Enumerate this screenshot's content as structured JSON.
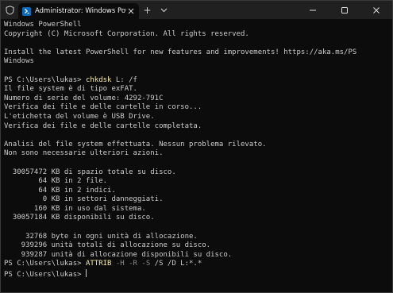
{
  "window": {
    "tab_title": "Administrator: Windows PowerShell",
    "new_tab_glyph": "+",
    "dropdown_glyph": "⌄"
  },
  "icons": [
    "shield-icon",
    "powershell-icon",
    "close-icon",
    "plus-icon",
    "chevron-down-icon",
    "minimize-icon",
    "maximize-icon",
    "window-close-icon"
  ],
  "colors": {
    "background": "#0c0c0c",
    "titlebar": "#202020",
    "text": "#cccccc",
    "command": "#f9f1a5",
    "parameter": "#8a8a8a",
    "powershell_icon": "#0b6ab8"
  },
  "console": {
    "lines": [
      {
        "segments": [
          {
            "text": "Windows PowerShell",
            "style": "plain"
          }
        ]
      },
      {
        "segments": [
          {
            "text": "Copyright (C) Microsoft Corporation. All rights reserved.",
            "style": "plain"
          }
        ]
      },
      {
        "segments": [
          {
            "text": "",
            "style": "plain"
          }
        ]
      },
      {
        "segments": [
          {
            "text": "Install the latest PowerShell for new features and improvements! https://aka.ms/PS",
            "style": "plain"
          }
        ]
      },
      {
        "segments": [
          {
            "text": "Windows",
            "style": "plain"
          }
        ]
      },
      {
        "segments": [
          {
            "text": "",
            "style": "plain"
          }
        ]
      },
      {
        "segments": [
          {
            "text": "PS C:\\Users\\lukas> ",
            "style": "plain"
          },
          {
            "text": "chkdsk",
            "style": "cmd"
          },
          {
            "text": " L: /f",
            "style": "plain"
          }
        ]
      },
      {
        "segments": [
          {
            "text": "Il file system è di tipo exFAT.",
            "style": "plain"
          }
        ]
      },
      {
        "segments": [
          {
            "text": "Numero di serie del volume: 4292-791C",
            "style": "plain"
          }
        ]
      },
      {
        "segments": [
          {
            "text": "Verifica dei file e delle cartelle in corso...",
            "style": "plain"
          }
        ]
      },
      {
        "segments": [
          {
            "text": "L'etichetta del volume è USB Drive.",
            "style": "plain"
          }
        ]
      },
      {
        "segments": [
          {
            "text": "Verifica dei file e delle cartelle completata.",
            "style": "plain"
          }
        ]
      },
      {
        "segments": [
          {
            "text": "",
            "style": "plain"
          }
        ]
      },
      {
        "segments": [
          {
            "text": "Analisi del file system effettuata. Nessun problema rilevato.",
            "style": "plain"
          }
        ]
      },
      {
        "segments": [
          {
            "text": "Non sono necessarie ulteriori azioni.",
            "style": "plain"
          }
        ]
      },
      {
        "segments": [
          {
            "text": "",
            "style": "plain"
          }
        ]
      },
      {
        "segments": [
          {
            "text": "  30057472 KB di spazio totale su disco.",
            "style": "plain"
          }
        ]
      },
      {
        "segments": [
          {
            "text": "        64 KB in 2 file.",
            "style": "plain"
          }
        ]
      },
      {
        "segments": [
          {
            "text": "        64 KB in 2 indici.",
            "style": "plain"
          }
        ]
      },
      {
        "segments": [
          {
            "text": "         0 KB in settori danneggiati.",
            "style": "plain"
          }
        ]
      },
      {
        "segments": [
          {
            "text": "       160 KB in uso dal sistema.",
            "style": "plain"
          }
        ]
      },
      {
        "segments": [
          {
            "text": "  30057184 KB disponibili su disco.",
            "style": "plain"
          }
        ]
      },
      {
        "segments": [
          {
            "text": "",
            "style": "plain"
          }
        ]
      },
      {
        "segments": [
          {
            "text": "     32768 byte in ogni unità di allocazione.",
            "style": "plain"
          }
        ]
      },
      {
        "segments": [
          {
            "text": "    939296 unità totali di allocazione su disco.",
            "style": "plain"
          }
        ]
      },
      {
        "segments": [
          {
            "text": "    939287 unità di allocazione disponibili su disco.",
            "style": "plain"
          }
        ]
      },
      {
        "segments": [
          {
            "text": "PS C:\\Users\\lukas> ",
            "style": "plain"
          },
          {
            "text": "ATTRIB",
            "style": "cmd"
          },
          {
            "text": " -H -R -S",
            "style": "param"
          },
          {
            "text": " /S /D L:*.*",
            "style": "plain"
          }
        ]
      },
      {
        "segments": [
          {
            "text": "PS C:\\Users\\lukas> ",
            "style": "plain"
          }
        ],
        "cursor": true
      }
    ]
  }
}
